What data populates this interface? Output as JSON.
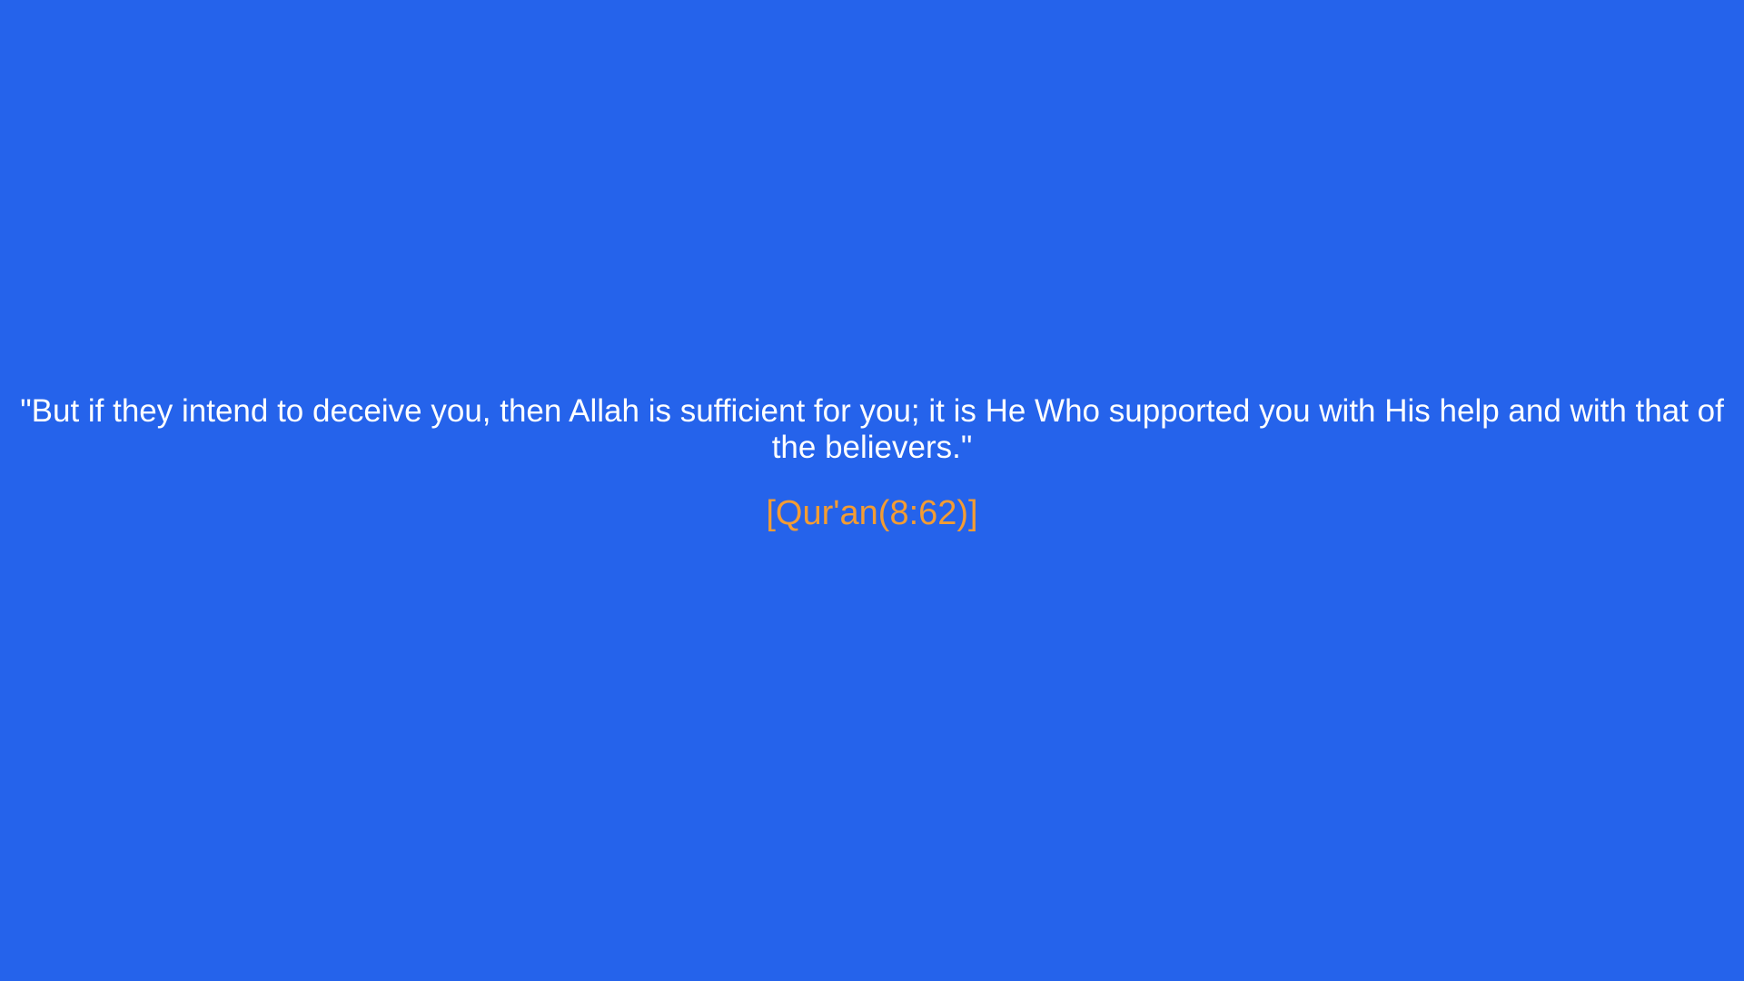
{
  "quote": {
    "text": "\"But if they intend to deceive you, then Allah is sufficient for you; it is He Who supported you with His help and with that of the believers.\"",
    "source": "[Qur'an(8:62)]"
  },
  "colors": {
    "background": "#2563eb",
    "quote_text": "#ffffff",
    "source_text": "#f39c33"
  }
}
